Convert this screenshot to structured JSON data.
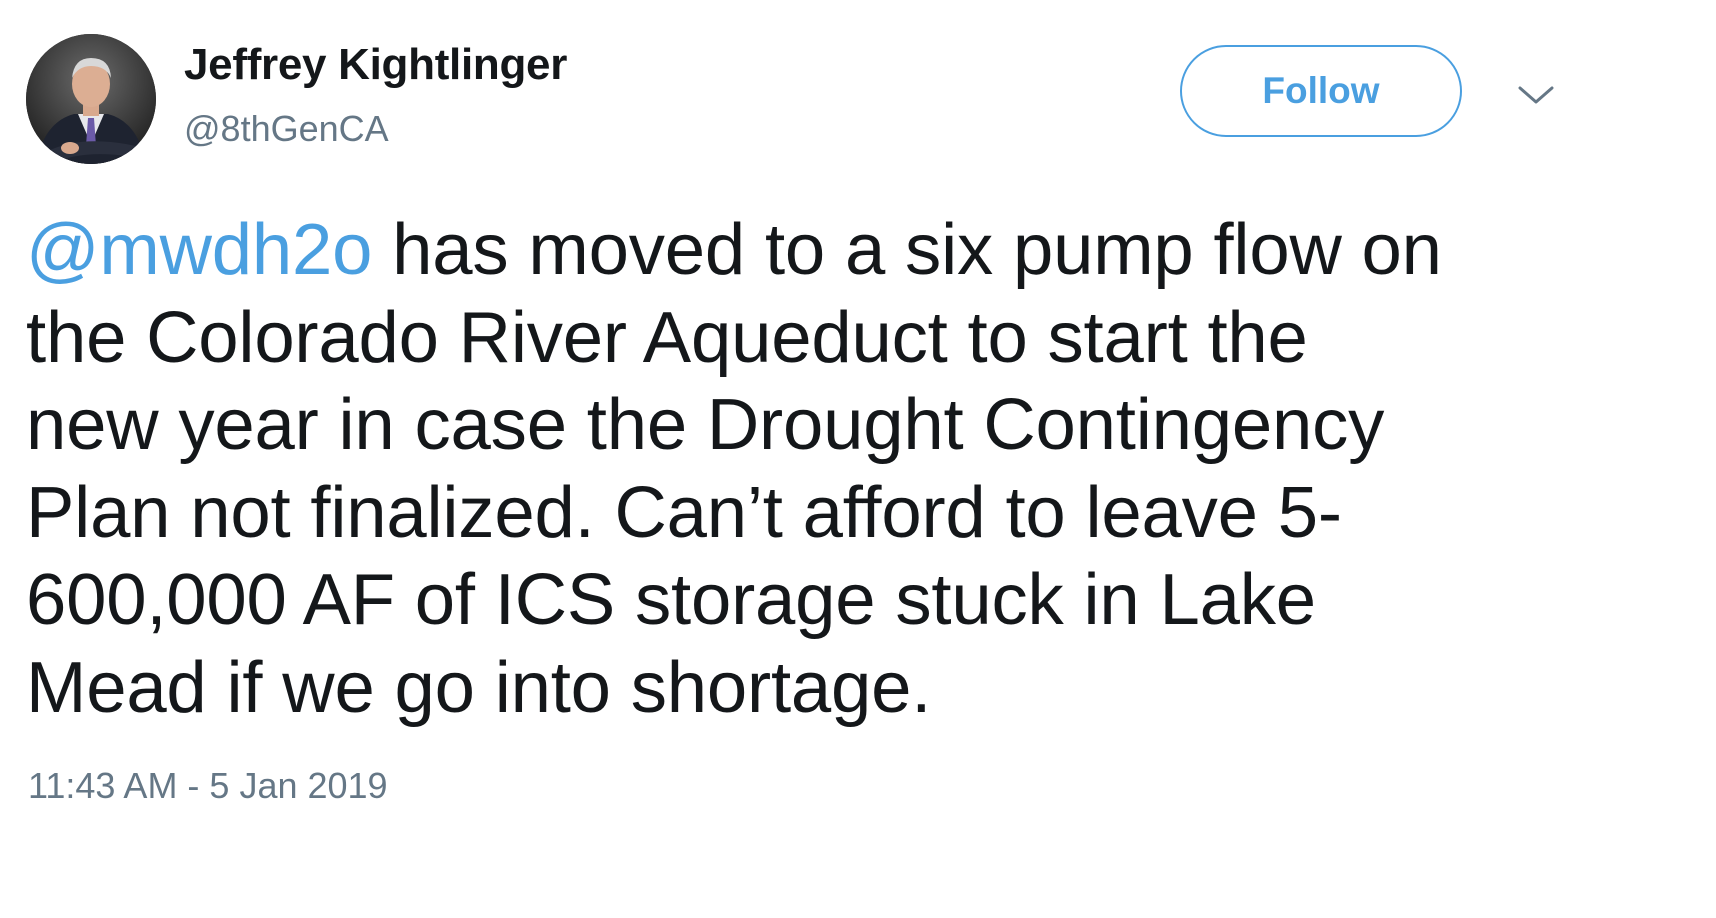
{
  "user": {
    "name": "Jeffrey Kightlinger",
    "handle": "@8thGenCA",
    "avatar_icon": "profile-photo"
  },
  "actions": {
    "follow_label": "Follow",
    "menu_icon": "chevron-down-icon"
  },
  "tweet": {
    "mention": "@mwdh2o",
    "text": " has moved to a six pump flow on\nthe Colorado River Aqueduct to start the\nnew year in case the Drought Contingency\nPlan not finalized.  Can’t afford to leave 5-\n600,000 AF of ICS storage stuck in Lake\nMead if we go into shortage.",
    "timestamp": "11:43 AM - 5 Jan 2019"
  },
  "colors": {
    "accent": "#4a9fe0",
    "text": "#14171a",
    "secondary": "#657786"
  }
}
